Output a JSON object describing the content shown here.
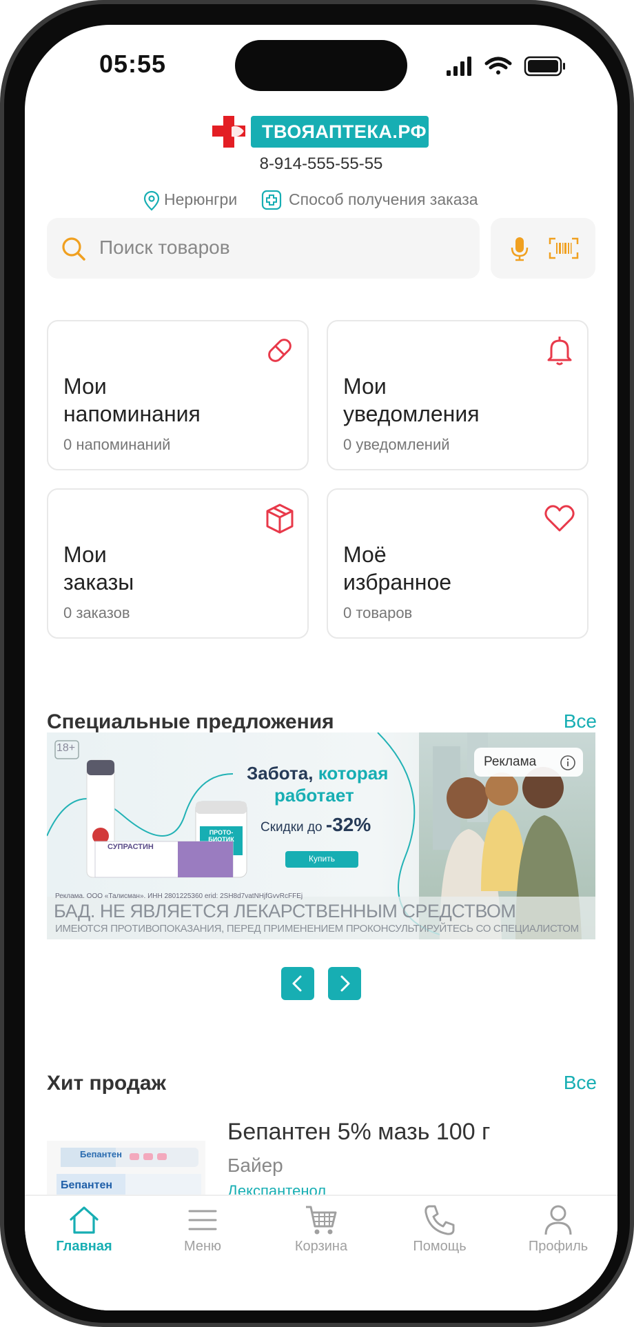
{
  "status_bar": {
    "time": "05:55"
  },
  "header": {
    "logo_text": "ТВОЯАПТЕКА.РФ",
    "phone": "8-914-555-55-55",
    "city": "Нерюнгри",
    "delivery_label": "Способ получения заказа"
  },
  "search": {
    "placeholder": "Поиск товаров"
  },
  "cards": [
    {
      "title_line1": "Мои",
      "title_line2": "напоминания",
      "subtitle": "0 напоминаний",
      "icon": "pill-icon"
    },
    {
      "title_line1": "Мои",
      "title_line2": "уведомления",
      "subtitle": "0 уведомлений",
      "icon": "bell-icon"
    },
    {
      "title_line1": "Мои",
      "title_line2": "заказы",
      "subtitle": "0 заказов",
      "icon": "box-icon"
    },
    {
      "title_line1": "Моё",
      "title_line2": "избранное",
      "subtitle": "0 товаров",
      "icon": "heart-icon"
    }
  ],
  "special_offers": {
    "title": "Специальные предложения",
    "all_label": "Все",
    "banner": {
      "age_label": "18+",
      "headline_part1": "Забота,",
      "headline_part2": "которая",
      "headline_line2": "работает",
      "discount_prefix": "Скидки до",
      "discount_value": "-32%",
      "buy_label": "Купить",
      "ad_label": "Реклама",
      "product1_name": "СУПРАСТИН",
      "product2_name": "ПРОТО-БИОТИК",
      "legal_small": "Реклама. ООО «Талисман». ИНН 2801225360 erid: 2SH8d7vatNHjfGvvRcFFEj",
      "warning_line1": "БАД. НЕ ЯВЛЯЕТСЯ ЛЕКАРСТВЕННЫМ СРЕДСТВОМ",
      "warning_line2": "ИМЕЮТСЯ ПРОТИВОПОКАЗАНИЯ, ПЕРЕД ПРИМЕНЕНИЕМ ПРОКОНСУЛЬТИРУЙТЕСЬ СО СПЕЦИАЛИСТОМ"
    }
  },
  "bestsellers": {
    "title": "Хит продаж",
    "all_label": "Все",
    "product": {
      "name": "Бепантен 5% мазь 100 г",
      "maker": "Байер",
      "substance": "Декспантенол",
      "package_label": "Бепантен"
    }
  },
  "tabbar": [
    {
      "label": "Главная",
      "icon": "home-icon",
      "active": true
    },
    {
      "label": "Меню",
      "icon": "menu-icon",
      "active": false
    },
    {
      "label": "Корзина",
      "icon": "cart-icon",
      "active": false
    },
    {
      "label": "Помощь",
      "icon": "phone-icon",
      "active": false
    },
    {
      "label": "Профиль",
      "icon": "profile-icon",
      "active": false
    }
  ],
  "colors": {
    "accent": "#17aeb3",
    "icon_red": "#e8394a",
    "icon_orange": "#f0a020"
  }
}
